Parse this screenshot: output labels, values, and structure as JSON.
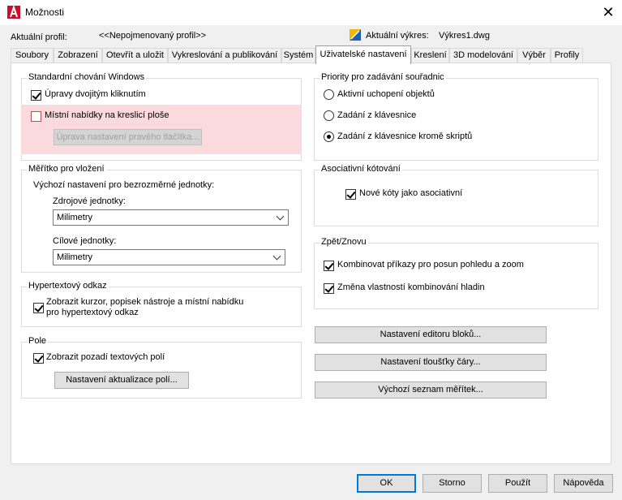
{
  "window": {
    "title": "Možnosti",
    "app_icon": "autocad-a-icon",
    "close_icon": "close-icon",
    "close_glyph": "✕"
  },
  "header": {
    "profile_label": "Aktuální profil:",
    "profile_value": "<<Nepojmenovaný profil>>",
    "drawing_label": "Aktuální výkres:",
    "drawing_value": "Výkres1.dwg",
    "drawing_icon": "drawing-file-icon"
  },
  "tabs": [
    {
      "label": "Soubory"
    },
    {
      "label": "Zobrazení"
    },
    {
      "label": "Otevřít a uložit"
    },
    {
      "label": "Vykreslování a publikování"
    },
    {
      "label": "Systém"
    },
    {
      "label": "Uživatelské nastavení",
      "active": true
    },
    {
      "label": "Kreslení"
    },
    {
      "label": "3D modelování"
    },
    {
      "label": "Výběr"
    },
    {
      "label": "Profily"
    }
  ],
  "windows_behavior": {
    "title": "Standardní chování Windows",
    "double_click_edit": {
      "label": "Úpravy dvojitým kliknutím",
      "checked": true
    },
    "shortcut_menus": {
      "label": "Místní nabídky na kreslicí ploše",
      "checked": false
    },
    "right_click_button": "Úprava nastavení pravého tlačítka..."
  },
  "insertion_scale": {
    "title": "Měřítko pro vložení",
    "subtitle": "Výchozí nastavení pro bezrozměrné jednotky:",
    "source_label": "Zdrojové jednotky:",
    "source_value": "Milimetry",
    "target_label": "Cílové jednotky:",
    "target_value": "Milimetry"
  },
  "hyperlink": {
    "title": "Hypertextový odkaz",
    "option_line1": "Zobrazit kurzor, popisek nástroje a místní nabídku",
    "option_line2": "pro hypertextový odkaz",
    "checked": true
  },
  "fields": {
    "title": "Pole",
    "background_label": "Zobrazit pozadí textových polí",
    "background_checked": true,
    "update_button": "Nastavení aktualizace polí..."
  },
  "coordinate_priority": {
    "title": "Priority pro zadávání souřadnic",
    "options": [
      {
        "label": "Aktivní uchopení objektů",
        "checked": false
      },
      {
        "label": "Zadání z klávesnice",
        "checked": false
      },
      {
        "label": "Zadání z klávesnice kromě skriptů",
        "checked": true
      }
    ]
  },
  "assoc_dim": {
    "title": "Asociativní kótování",
    "label": "Nové kóty jako asociativní",
    "checked": true
  },
  "undo_redo": {
    "title": "Zpět/Znovu",
    "combine_zoom": {
      "label": "Kombinovat příkazy pro posun pohledu a zoom",
      "checked": true
    },
    "combine_layer": {
      "label": "Změna vlastností kombinování hladin",
      "checked": true
    }
  },
  "side_buttons": {
    "block_editor": "Nastavení editoru bloků...",
    "lineweight": "Nastavení tloušťky čáry...",
    "scale_list": "Výchozí seznam měřítek..."
  },
  "footer": {
    "ok": "OK",
    "cancel": "Storno",
    "apply": "Použít",
    "help": "Nápověda"
  },
  "colors": {
    "highlight": "#fadadd",
    "focus_border": "#0078d7",
    "app_icon_red": "#c8102e"
  }
}
